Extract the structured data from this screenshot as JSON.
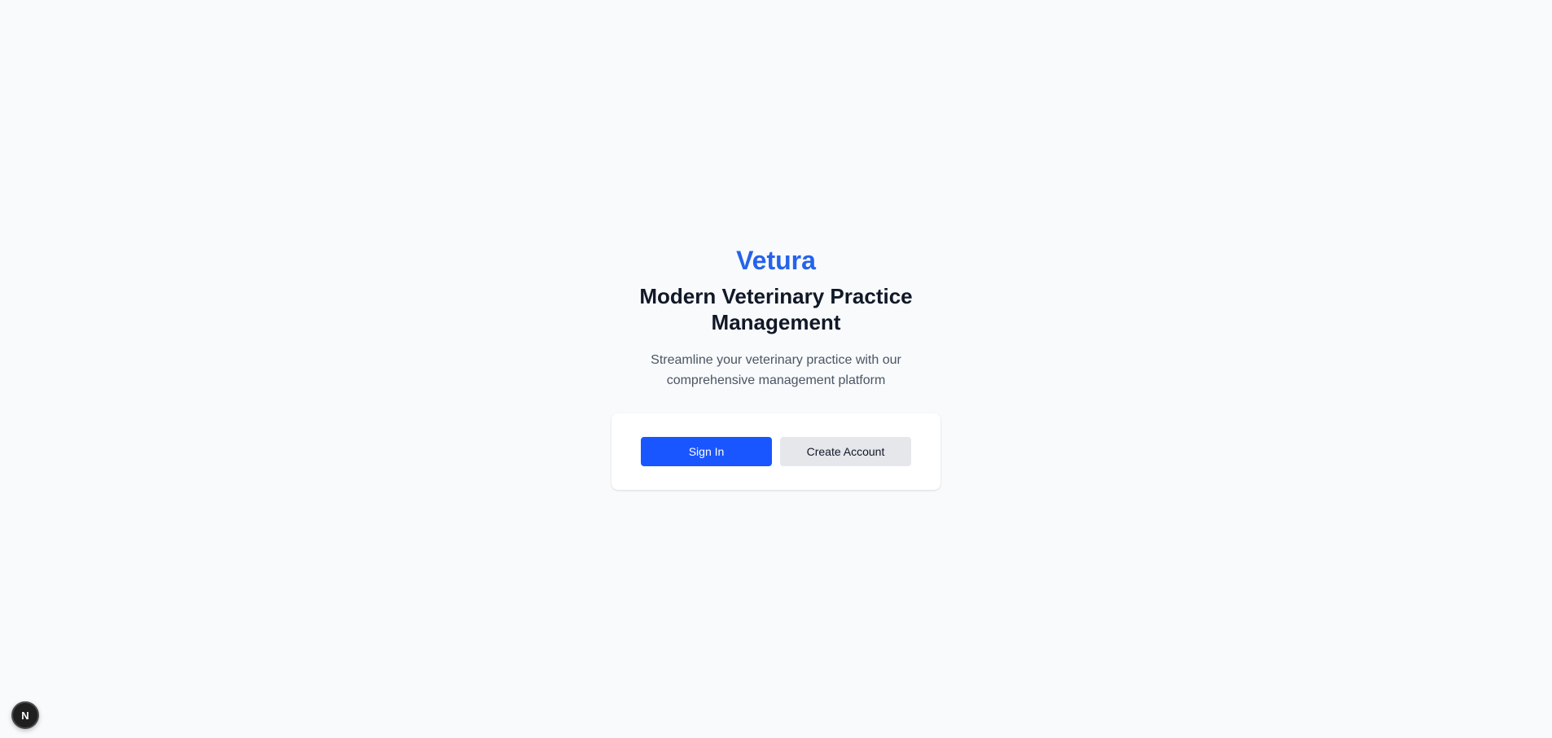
{
  "brand": {
    "name": "Vetura",
    "color": "#2563eb"
  },
  "hero": {
    "headline": "Modern Veterinary Practice Management",
    "subtitle": "Streamline your veterinary practice with our comprehensive management platform"
  },
  "actions": {
    "sign_in_label": "Sign In",
    "create_account_label": "Create Account",
    "primary_color": "#1a56ff",
    "secondary_color": "#e5e7eb"
  },
  "dev_badge": {
    "icon": "nextjs-logo-icon",
    "letter": "N"
  }
}
